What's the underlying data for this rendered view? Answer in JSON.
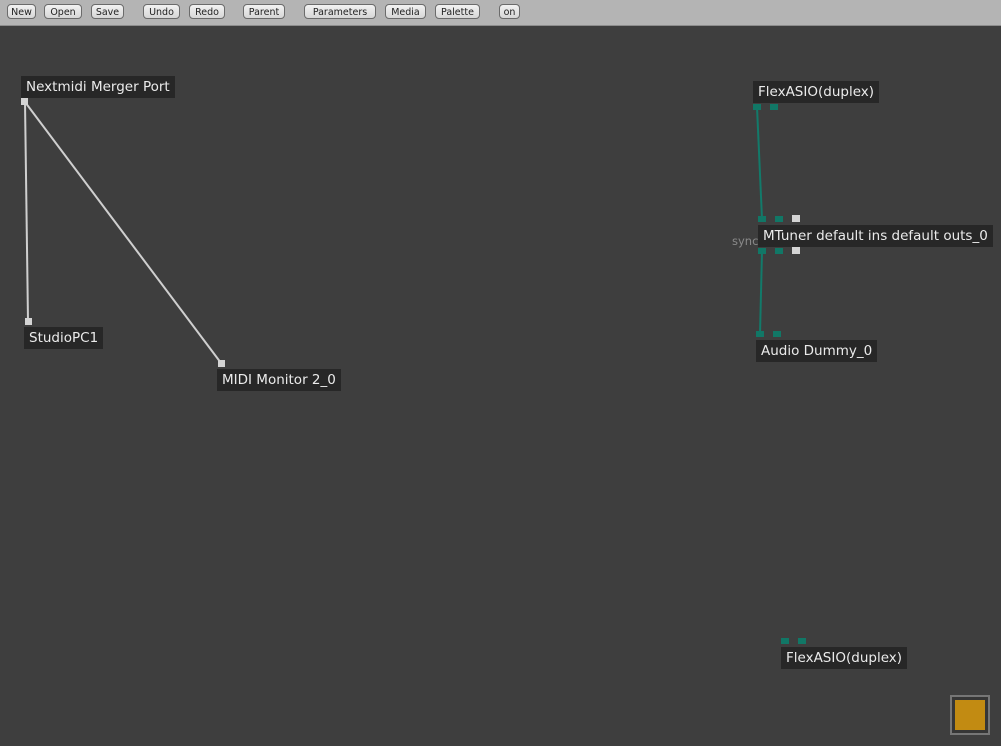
{
  "toolbar": {
    "buttons": {
      "new": "New",
      "open": "Open",
      "save": "Save",
      "undo": "Undo",
      "redo": "Redo",
      "parent": "Parent",
      "parameters": "Parameters",
      "media": "Media",
      "palette": "Palette",
      "on": "on"
    }
  },
  "nodes": {
    "nextmidi": "Nextmidi Merger Port",
    "studiopc": "StudioPC1",
    "midi_monitor": "MIDI Monitor 2_0",
    "flexasio_top": "FlexASIO(duplex)",
    "mtuner": "MTuner default ins default outs_0",
    "audio_dummy": "Audio Dummy_0",
    "flexasio_bottom": "FlexASIO(duplex)"
  },
  "sync_label": "sync",
  "colors": {
    "background": "#3e3e3e",
    "toolbar": "#b4b4b4",
    "node_label_bg": "#272727",
    "audio_port": "#117766",
    "midi_port": "#d4d4d4",
    "audio_wire": "#127a6a",
    "midi_wire": "#cfcfcf",
    "corner_swatch": "#c28b12"
  }
}
